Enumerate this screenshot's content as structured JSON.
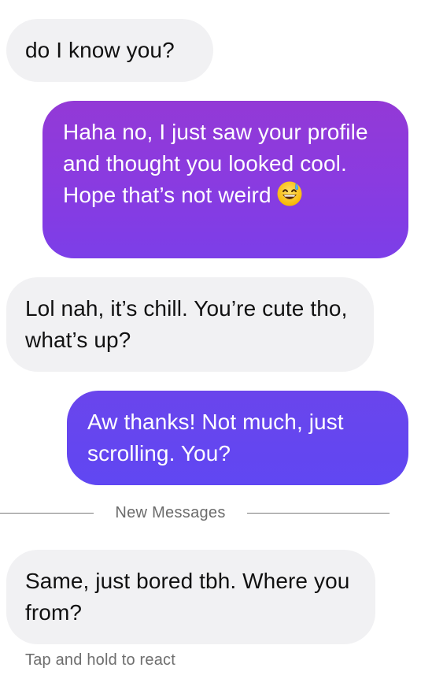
{
  "messages": [
    {
      "direction": "incoming",
      "text": "do I know you?"
    },
    {
      "direction": "outgoing",
      "text": "Haha no, I just saw your profile and thought you looked cool. Hope that’s not weird",
      "emoji": "grinning-sweat-emoji"
    },
    {
      "direction": "incoming",
      "text": "Lol nah, it’s chill. You’re cute tho, what’s up?"
    },
    {
      "direction": "outgoing",
      "text": "Aw thanks! Not much, just scrolling. You?"
    },
    {
      "direction": "incoming",
      "text": "Same, just bored tbh. Where you from?"
    }
  ],
  "divider": {
    "label": "New Messages"
  },
  "hint": {
    "text": "Tap and hold to react"
  },
  "colors": {
    "incoming_bubble": "#f1f1f3",
    "outgoing_gradient_start": "#9339d6",
    "outgoing_gradient_end": "#6047f2",
    "divider_text": "#6b6b6b"
  }
}
